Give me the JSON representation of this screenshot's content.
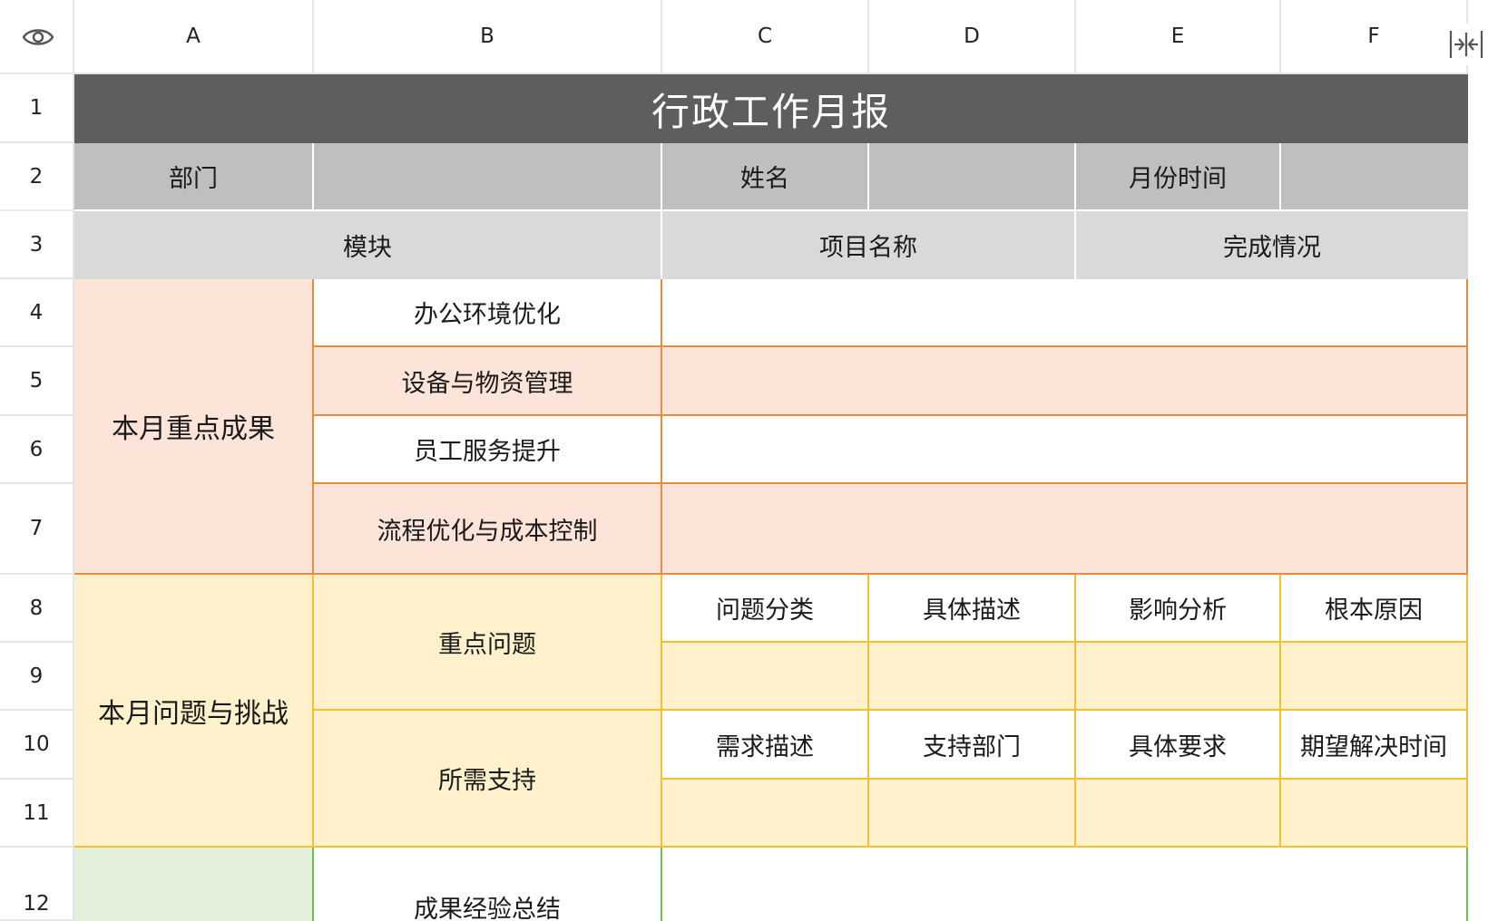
{
  "columns": [
    "A",
    "B",
    "C",
    "D",
    "E",
    "F"
  ],
  "rows": [
    "1",
    "2",
    "3",
    "4",
    "5",
    "6",
    "7",
    "8",
    "9",
    "10",
    "11",
    "12"
  ],
  "title": "行政工作月报",
  "row2": {
    "dept": "部门",
    "name": "姓名",
    "month": "月份时间"
  },
  "row3": {
    "module": "模块",
    "project": "项目名称",
    "status": "完成情况"
  },
  "achievements": {
    "label": "本月重点成果",
    "items": [
      "办公环境优化",
      "设备与物资管理",
      "员工服务提升",
      "流程优化与成本控制"
    ]
  },
  "problems": {
    "label": "本月问题与挑战",
    "key_issue": "重点问题",
    "issue_headers": [
      "问题分类",
      "具体描述",
      "影响分析",
      "根本原因"
    ],
    "support": "所需支持",
    "support_headers": [
      "需求描述",
      "支持部门",
      "具体要求",
      "期望解决时间"
    ]
  },
  "summary": {
    "item": "成果经验总结"
  },
  "colors": {
    "title_bg": "#5e5e5e",
    "header_gray": "#bfbfbf",
    "module_gray": "#d9d9d9",
    "orange_fill": "#fde4d8",
    "orange_border": "#e98a3c",
    "yellow_fill": "#fef1cb",
    "yellow_border": "#f1c12e",
    "green_fill": "#e3f0da",
    "green_border": "#7cb65a"
  },
  "icons": {
    "visibility": "eye-icon",
    "collapse": "collapse-columns-icon"
  }
}
